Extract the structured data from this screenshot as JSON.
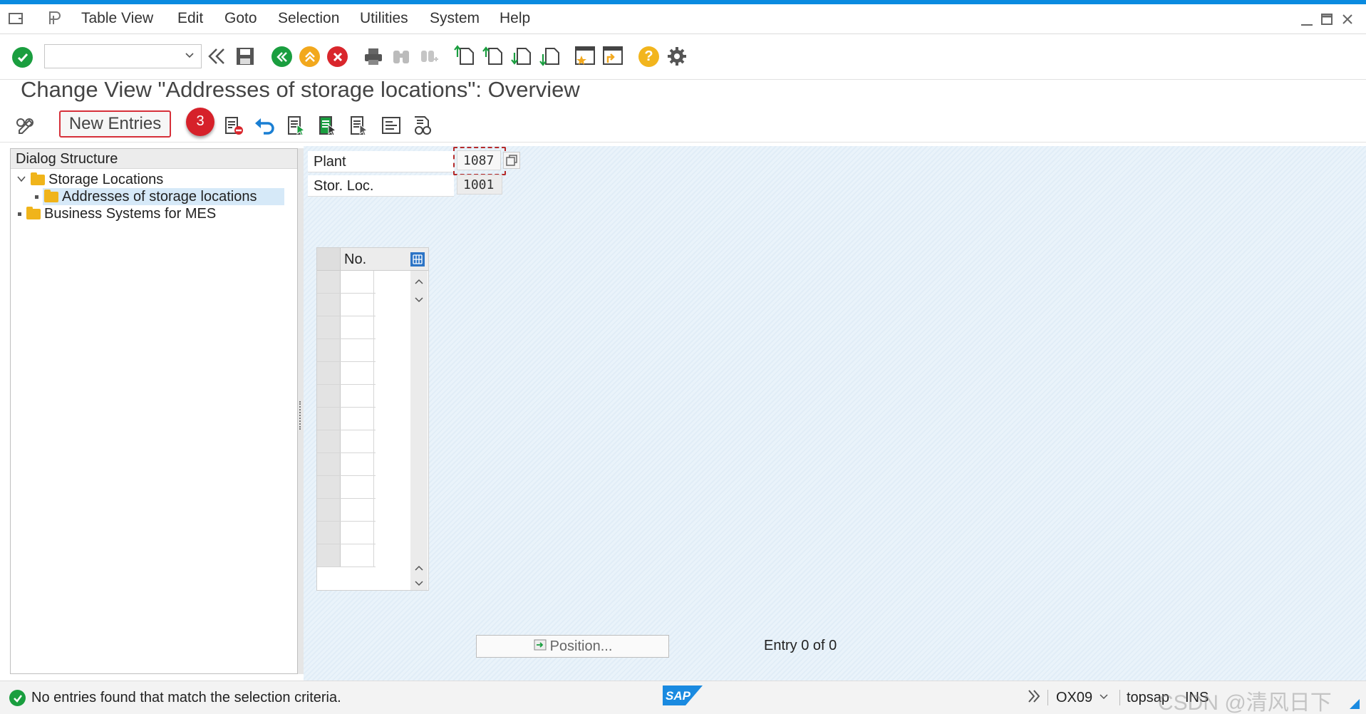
{
  "menu": {
    "items": [
      "Table View",
      "Edit",
      "Goto",
      "Selection",
      "Utilities",
      "System",
      "Help"
    ]
  },
  "toolbar": {
    "command_placeholder": "",
    "help_glyph": "?"
  },
  "title": "Change View \"Addresses of storage locations\": Overview",
  "app_toolbar": {
    "new_entries_label": "New Entries",
    "callout_number": "3"
  },
  "dialog_structure": {
    "header": "Dialog Structure",
    "items": [
      {
        "label": "Storage Locations",
        "level": 0,
        "expanded": true
      },
      {
        "label": "Addresses of storage locations",
        "level": 1,
        "selected": true
      },
      {
        "label": "Business Systems for MES",
        "level": 0
      }
    ]
  },
  "fields": {
    "plant_label": "Plant",
    "plant_value": "1087",
    "storloc_label": "Stor. Loc.",
    "storloc_value": "1001"
  },
  "table": {
    "column_no": "No.",
    "row_count": 13
  },
  "footer": {
    "position_label": "Position...",
    "entry_text": "Entry 0 of 0"
  },
  "status": {
    "message": "No entries found that match the selection criteria.",
    "sap_logo": "SAP",
    "transaction": "OX09",
    "server": "topsap",
    "mode": "INS",
    "watermark": "CSDN @清风日下"
  },
  "colors": {
    "accent": "#0a8be0",
    "callout": "#d6212a",
    "ok_green": "#1a9e3f",
    "cancel_red": "#d9262c",
    "nav_orange": "#f2a81d"
  }
}
